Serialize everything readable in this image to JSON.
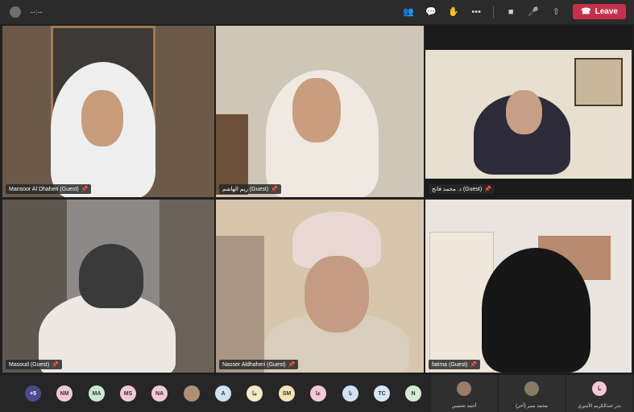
{
  "meeting": {
    "timer": "--:--",
    "leave_label": "Leave"
  },
  "participants": [
    {
      "name": "Mansoor Al Dhaheri (Guest)",
      "bg": "#6b5a48"
    },
    {
      "name": "ريم الهاشم (Guest)",
      "bg": "#cfc6b8"
    },
    {
      "name": "د. محمد فاتح (Guest)",
      "bg": "#d9c3a1"
    },
    {
      "name": "Masoud (Guest)",
      "bg": "#8b8a86"
    },
    {
      "name": "Nasser Aldhaheri (Guest)",
      "bg": "#d7c6ae"
    },
    {
      "name": "fatima (Guest)",
      "bg": "#e9e4de"
    }
  ],
  "roster": {
    "overflow": "+5",
    "chips": [
      {
        "label": "NM",
        "color": "#f1c9d5"
      },
      {
        "label": "MA",
        "color": "#c9e8d3"
      },
      {
        "label": "MS",
        "color": "#f3c8d8"
      },
      {
        "label": "NA",
        "color": "#f3c8d8"
      },
      {
        "label": "",
        "color": "#b08f74"
      },
      {
        "label": "A",
        "color": "#cfe1f3"
      },
      {
        "label": "ما",
        "color": "#f3e8c9"
      },
      {
        "label": "SM",
        "color": "#f3e3b5"
      },
      {
        "label": "عا",
        "color": "#f3c8d8"
      },
      {
        "label": "نا",
        "color": "#cfe1f3"
      },
      {
        "label": "TC",
        "color": "#d7e6f5"
      },
      {
        "label": "N",
        "color": "#d3ecd3"
      }
    ],
    "spotlight": [
      {
        "name": "أحمد تحسين",
        "initials": ""
      },
      {
        "name": "محمد منير (آخر)",
        "initials": ""
      },
      {
        "name": "بدر عبدالكريم الأميري",
        "initials": "با"
      }
    ]
  }
}
